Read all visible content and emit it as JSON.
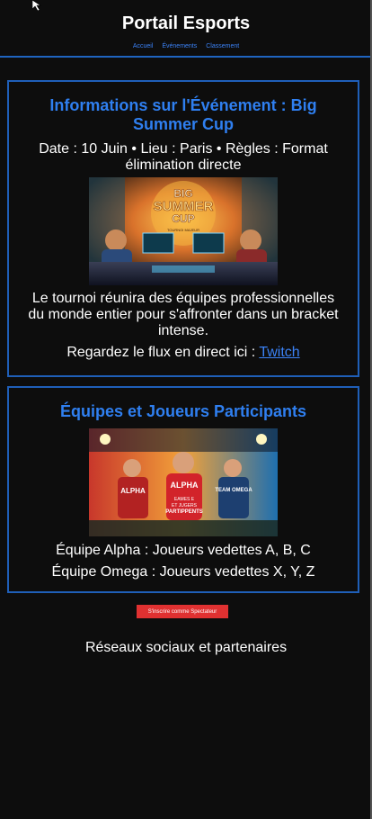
{
  "header": {
    "title": "Portail Esports",
    "nav": [
      {
        "label": "Accueil"
      },
      {
        "label": "Événements"
      },
      {
        "label": "Classement"
      }
    ]
  },
  "event": {
    "heading": "Informations sur l'Événement : Big Summer Cup",
    "meta": "Date : 10 Juin • Lieu : Paris • Règles : Format élimination directe",
    "image": {
      "subject": "esports tournament arena illustration",
      "sign_text": [
        "BIG",
        "SUMMER",
        "CUP"
      ],
      "sub_text": "TOURNOI MAJEUR"
    },
    "description": "Le tournoi réunira des équipes professionnelles du monde entier pour s'affronter dans un bracket intense.",
    "stream_prefix": "Regardez le flux en direct ici : ",
    "stream_link": "Twitch"
  },
  "teams": {
    "heading": "Équipes et Joueurs Participants",
    "image": {
      "subject": "team players illustration",
      "jersey_left": "ALPHA",
      "jersey_center": "ALPHA",
      "jersey_right": "TEAM OMEGA",
      "banner_text": [
        "EAMES E",
        "ET JUGERS",
        "PARTIPPENTS"
      ]
    },
    "lines": [
      "Équipe Alpha : Joueurs vedettes A, B, C",
      "Équipe Omega : Joueurs vedettes X, Y, Z"
    ]
  },
  "cta": {
    "label": "S'inscrire comme Spectateur",
    "color": "#e03131"
  },
  "footer": {
    "partners": "Réseaux sociaux et partenaires"
  },
  "colors": {
    "background": "#0d0d0d",
    "accent": "#2f7ff0",
    "border": "#1f5fb8"
  }
}
